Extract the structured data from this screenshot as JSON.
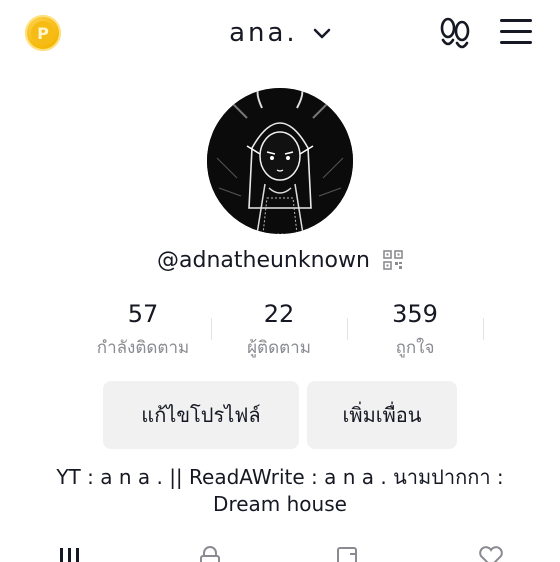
{
  "header": {
    "coin_icon": "coin-icon",
    "coin_glyph": "P",
    "title": "ana.",
    "visitors_icon": "footprints-icon",
    "menu_icon": "hamburger-menu-icon"
  },
  "profile": {
    "avatar_icon": "avatar-image",
    "username": "@adnatheunknown",
    "qr_icon": "qr-code-icon"
  },
  "stats": [
    {
      "value": "57",
      "label": "กำลังติดตาม"
    },
    {
      "value": "22",
      "label": "ผู้ติดตาม"
    },
    {
      "value": "359",
      "label": "ถูกใจ"
    }
  ],
  "buttons": {
    "edit_profile": "แก้ไขโปรไฟล์",
    "add_friends": "เพิ่มเพื่อน"
  },
  "bio": {
    "line1": "YT : a n a . || ReadAWrite : a n a . นามปากกา :",
    "line2": "Dream house"
  },
  "tabs": [
    "videos-grid-icon",
    "lock-icon",
    "repost-icon",
    "liked-heart-icon"
  ],
  "colors": {
    "text": "#161823",
    "secondary": "#8a8b91",
    "button_bg": "#f1f1f2",
    "coin": "#f4b400"
  }
}
